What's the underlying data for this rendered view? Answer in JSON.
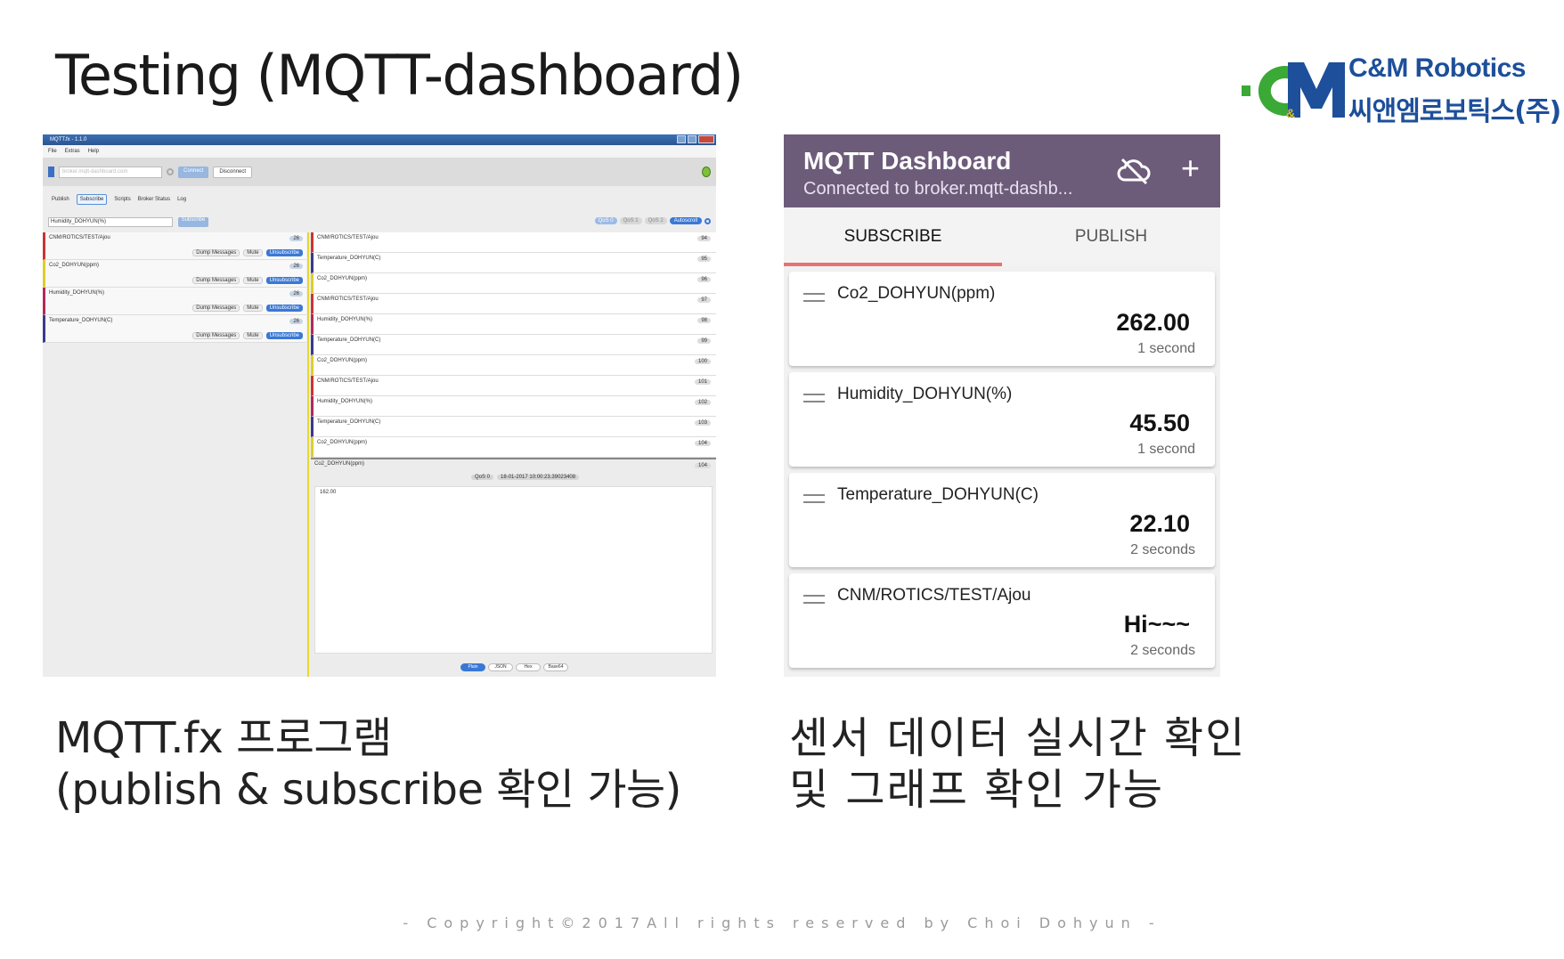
{
  "slide": {
    "title": "Testing (MQTT-dashboard)",
    "caption_left": [
      "MQTT.fx 프로그램",
      "(publish & subscribe 확인 가능)"
    ],
    "caption_right": [
      "센서 데이터 실시간 확인",
      "및 그래프 확인 가능"
    ],
    "copyright": "- Copyright©2017All rights reserved by Choi Dohyun -"
  },
  "logo": {
    "name_en": "C&M Robotics",
    "name_ko": "씨앤엠로보틱스(주)",
    "colors": {
      "green": "#3aa935",
      "blue": "#1d4f9a"
    }
  },
  "mqttfx": {
    "window_title": "MQTT.fx - 1.1.0",
    "menu": [
      "File",
      "Extras",
      "Help"
    ],
    "broker_placeholder": "broker.mqtt-dashboard.com",
    "connect_label": "Connect",
    "disconnect_label": "Disconnect",
    "tabs": [
      "Publish",
      "Subscribe",
      "Scripts",
      "Broker Status",
      "Log"
    ],
    "active_tab": "Subscribe",
    "subscribe_topic": "Humidity_DOHYUN(%)",
    "subscribe_button": "Subscribe",
    "qos": [
      "QoS 0",
      "QoS 1",
      "QoS 2"
    ],
    "autoscroll_label": "Autoscroll",
    "subscriptions": [
      {
        "topic": "CNM/ROTICS/TEST/Ajou",
        "count": "26",
        "color": "#cc3333"
      },
      {
        "topic": "Co2_DOHYUN(ppm)",
        "count": "26",
        "color": "#e0cc2a"
      },
      {
        "topic": "Humidity_DOHYUN(%)",
        "count": "26",
        "color": "#b02a5a"
      },
      {
        "topic": "Temperature_DOHYUN(C)",
        "count": "26",
        "color": "#3a3a8a"
      }
    ],
    "sub_actions": {
      "dump": "Dump Messages",
      "mute": "Mute",
      "unsubscribe": "Unsubscribe"
    },
    "messages": [
      {
        "topic": "CNM/ROTICS/TEST/Ajou",
        "num": "94",
        "color": "#cc3333"
      },
      {
        "topic": "Temperature_DOHYUN(C)",
        "num": "95",
        "color": "#3a3a8a"
      },
      {
        "topic": "Co2_DOHYUN(ppm)",
        "num": "96",
        "color": "#e0cc2a"
      },
      {
        "topic": "CNM/ROTICS/TEST/Ajou",
        "num": "97",
        "color": "#cc3333"
      },
      {
        "topic": "Humidity_DOHYUN(%)",
        "num": "98",
        "color": "#b02a5a"
      },
      {
        "topic": "Temperature_DOHYUN(C)",
        "num": "99",
        "color": "#3a3a8a"
      },
      {
        "topic": "Co2_DOHYUN(ppm)",
        "num": "100",
        "color": "#e0cc2a"
      },
      {
        "topic": "CNM/ROTICS/TEST/Ajou",
        "num": "101",
        "color": "#cc3333"
      },
      {
        "topic": "Humidity_DOHYUN(%)",
        "num": "102",
        "color": "#b02a5a"
      },
      {
        "topic": "Temperature_DOHYUN(C)",
        "num": "103",
        "color": "#3a3a8a"
      },
      {
        "topic": "Co2_DOHYUN(ppm)",
        "num": "104",
        "color": "#e0cc2a"
      }
    ],
    "detail": {
      "topic": "Co2_DOHYUN(ppm)",
      "num": "104",
      "qos": "QoS 0",
      "timestamp": "18-01-2017 10:00:23.39023408",
      "payload": "162.00"
    },
    "formats": [
      "Plain",
      "JSON",
      "Hex",
      "Base64"
    ]
  },
  "dashboard": {
    "title": "MQTT Dashboard",
    "subtitle": "Connected to broker.mqtt-dashb...",
    "tabs": [
      "SUBSCRIBE",
      "PUBLISH"
    ],
    "active_tab": "SUBSCRIBE",
    "accent": "#6d5b7a",
    "tab_indicator": "#e57373",
    "cards": [
      {
        "topic": "Co2_DOHYUN(ppm)",
        "value": "262.00",
        "age": "1 second"
      },
      {
        "topic": "Humidity_DOHYUN(%)",
        "value": "45.50",
        "age": "1 second"
      },
      {
        "topic": "Temperature_DOHYUN(C)",
        "value": "22.10",
        "age": "2 seconds"
      },
      {
        "topic": "CNM/ROTICS/TEST/Ajou",
        "value": "Hi~~~",
        "age": "2 seconds"
      }
    ]
  }
}
